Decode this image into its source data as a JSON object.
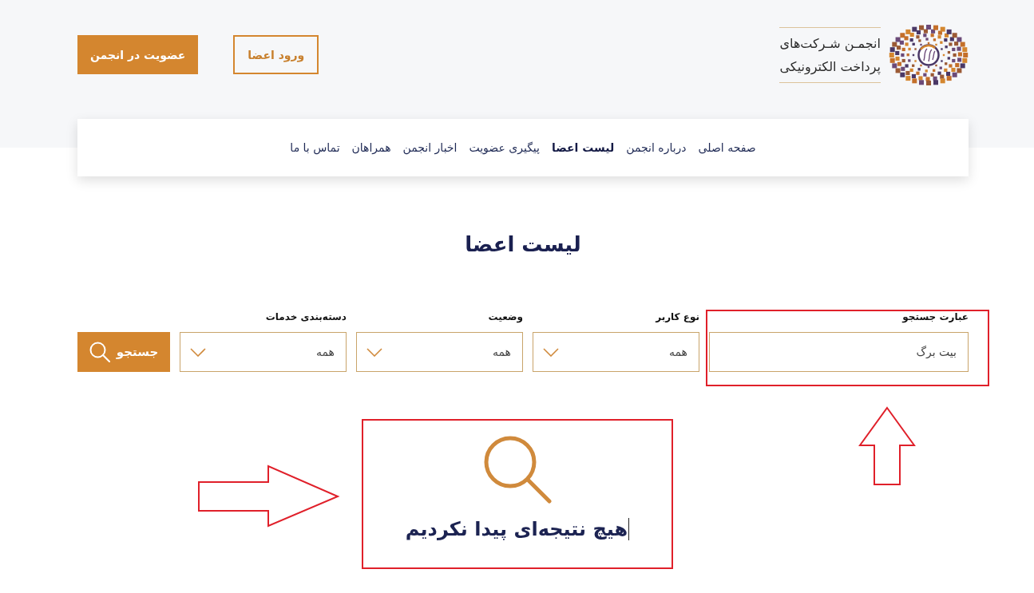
{
  "header": {
    "org_name": [
      "انجمـن شـرکت‌های",
      "پرداخت الکترونیکی"
    ],
    "buttons": [
      {
        "label": "ورود اعضا",
        "kind": "outline"
      },
      {
        "label": "عضویت در انجمن",
        "kind": "primary"
      }
    ]
  },
  "nav": [
    {
      "label": "صفحه اصلی",
      "selected": false
    },
    {
      "label": "درباره انجمن",
      "selected": false
    },
    {
      "label": "لیست اعضا",
      "selected": true
    },
    {
      "label": "پیگیری عضویت",
      "selected": false
    },
    {
      "label": "اخبار انجمن",
      "selected": false
    },
    {
      "label": "همراهان",
      "selected": false
    },
    {
      "label": "تماس با ما",
      "selected": false
    }
  ],
  "page_title": "لیست اعضا",
  "filters": [
    {
      "kind": "text",
      "label": "عبارت جستجو",
      "value": "بیت برگ"
    },
    {
      "kind": "select",
      "label": "نوع کاربر",
      "value": "همه"
    },
    {
      "kind": "select",
      "label": "وضعیت",
      "value": "همه"
    },
    {
      "kind": "select",
      "label": "دسته‌بندی خدمات",
      "value": "همه"
    }
  ],
  "search_button": {
    "label": "جستجو"
  },
  "empty_state": {
    "message": "هیچ نتیجه‌ای پیدا نکردیم"
  }
}
